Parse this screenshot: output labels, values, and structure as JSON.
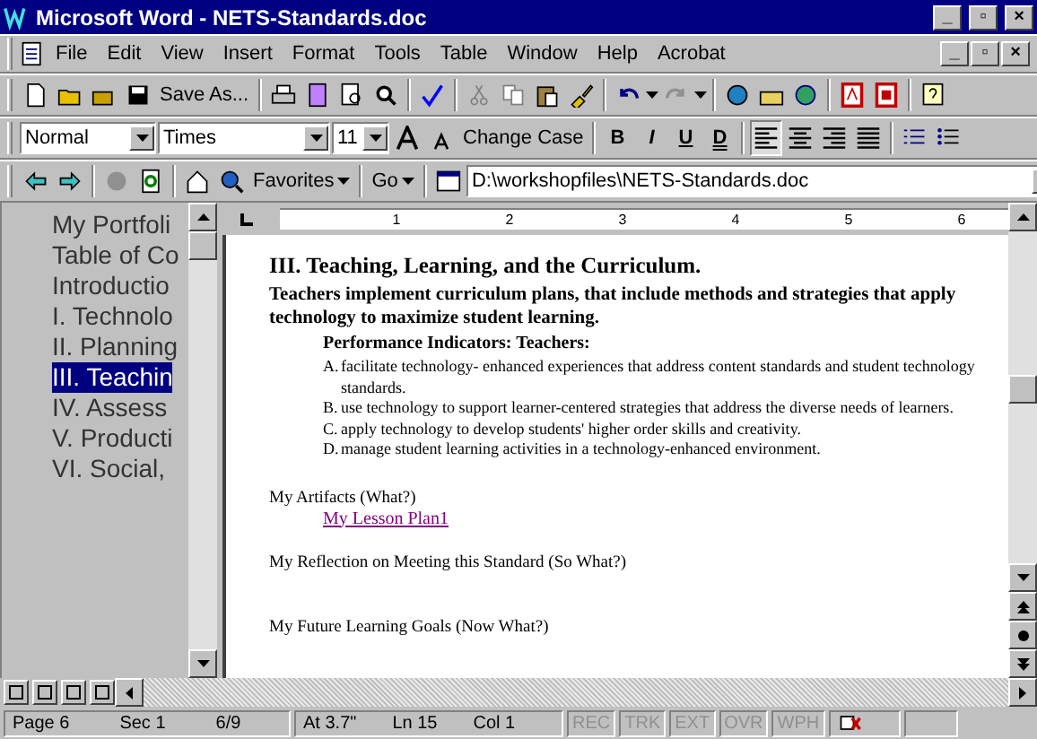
{
  "window": {
    "title": "Microsoft Word - NETS-Standards.doc",
    "controls": [
      "_",
      "▫",
      "×"
    ]
  },
  "menu": [
    "File",
    "Edit",
    "View",
    "Insert",
    "Format",
    "Tools",
    "Table",
    "Window",
    "Help",
    "Acrobat"
  ],
  "standard_toolbar": {
    "save_as": "Save As..."
  },
  "formatting_toolbar": {
    "style": "Normal",
    "font": "Times",
    "size": "11",
    "change_case": "Change Case",
    "bold": "B",
    "italic": "I",
    "underline": "U",
    "double_underline": "D",
    "alignment": [
      {
        "selected": true
      },
      {
        "selected": false
      },
      {
        "selected": false
      },
      {
        "selected": false
      }
    ]
  },
  "web_toolbar": {
    "favorites": "Favorites",
    "go": "Go",
    "address": "D:\\workshopfiles\\NETS-Standards.doc"
  },
  "document_map": [
    {
      "label": "My Portfoli",
      "selected": false
    },
    {
      "label": "Table of Co",
      "selected": false
    },
    {
      "label": "Introductio",
      "selected": false
    },
    {
      "label": "I. Technolo",
      "selected": false
    },
    {
      "label": "II. Planning",
      "selected": false
    },
    {
      "label": "III. Teachin",
      "selected": true
    },
    {
      "label": "IV. Assess",
      "selected": false
    },
    {
      "label": "V. Producti",
      "selected": false
    },
    {
      "label": "VI. Social,",
      "selected": false
    }
  ],
  "ruler": [
    "1",
    "2",
    "3",
    "4",
    "5",
    "6"
  ],
  "document": {
    "heading": "III. Teaching, Learning, and the Curriculum.",
    "standard": "Teachers implement curriculum plans, that include methods and strategies that apply technology to maximize student learning.",
    "indicators_title": "Performance Indicators: Teachers:",
    "indicators": [
      {
        "letter": "A.",
        "text": "facilitate technology- enhanced experiences that address content standards and student technology standards."
      },
      {
        "letter": "B.",
        "text": "use technology to support learner-centered strategies that address the diverse needs of learners."
      },
      {
        "letter": "C.",
        "text": "apply technology to develop students' higher order skills and creativity."
      },
      {
        "letter": "D.",
        "text": "manage student learning activities in a technology-enhanced environment."
      }
    ],
    "artifacts_label": "My Artifacts (What?)",
    "artifact_link": "My Lesson Plan1",
    "reflection_label": "My Reflection on Meeting this Standard (So What?)",
    "goals_label": "My Future Learning Goals (Now What?)"
  },
  "status_bar": {
    "page": "Page 6",
    "section": "Sec 1",
    "pages": "6/9",
    "at": "At 3.7\"",
    "line": "Ln 15",
    "column": "Col 1",
    "modes": [
      {
        "label": "REC",
        "active": false
      },
      {
        "label": "TRK",
        "active": false
      },
      {
        "label": "EXT",
        "active": false
      },
      {
        "label": "OVR",
        "active": false
      },
      {
        "label": "WPH",
        "active": false
      }
    ]
  }
}
